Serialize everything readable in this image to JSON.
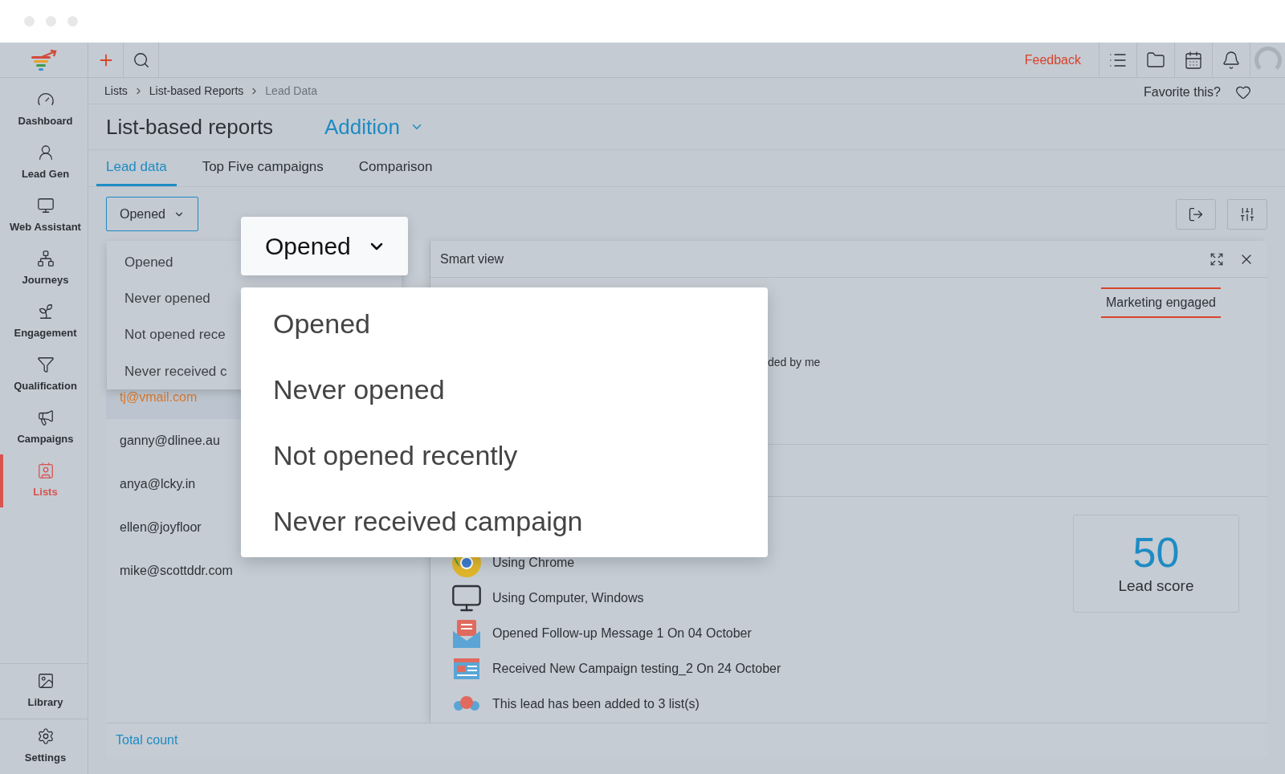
{
  "app_bar": {
    "feedback": "Feedback"
  },
  "sidebar": {
    "items": [
      {
        "label": "Dashboard",
        "selected": false
      },
      {
        "label": "Lead Gen",
        "selected": false
      },
      {
        "label": "Web Assistant",
        "selected": false
      },
      {
        "label": "Journeys",
        "selected": false
      },
      {
        "label": "Engagement",
        "selected": false
      },
      {
        "label": "Qualification",
        "selected": false
      },
      {
        "label": "Campaigns",
        "selected": false
      },
      {
        "label": "Lists",
        "selected": true
      }
    ],
    "bottom_items": [
      {
        "label": "Library",
        "selected": false
      },
      {
        "label": "Settings",
        "selected": false
      }
    ]
  },
  "breadcrumb": [
    "Lists",
    "List-based Reports",
    "Lead Data"
  ],
  "favorite": "Favorite this?",
  "title": "List-based reports",
  "report_selector": "Addition",
  "tabs": [
    {
      "label": "Lead data",
      "selected": true
    },
    {
      "label": "Top Five campaigns",
      "selected": false
    },
    {
      "label": "Comparison",
      "selected": false
    }
  ],
  "filter": {
    "value": "Opened",
    "options": [
      "Opened",
      "Never opened",
      "Not opened rece",
      "Never received c"
    ]
  },
  "zoomed_filter": {
    "value": "Opened",
    "options": [
      "Opened",
      "Never opened",
      "Not opened recently",
      "Never received campaign"
    ]
  },
  "leads": [
    {
      "email": "tj@vmail.com",
      "selected": true
    },
    {
      "email": "ganny@dlinee.au",
      "selected": false
    },
    {
      "email": "anya@lcky.in",
      "selected": false
    },
    {
      "email": "ellen@joyfloor",
      "selected": false
    },
    {
      "email": "mike@scottddr.com",
      "selected": false
    }
  ],
  "total_count": "Total count",
  "smart_view": {
    "title": "Smart view",
    "tag": "Marketing engaged",
    "note": "ded by me",
    "activities": [
      "Using Chrome",
      "Using Computer, Windows",
      "Opened Follow-up Message 1 On 04 October",
      "Received New Campaign testing_2 On 24 October",
      "This lead has been added to 3 list(s)"
    ],
    "lead_score": {
      "value": "50",
      "label": "Lead score"
    }
  }
}
